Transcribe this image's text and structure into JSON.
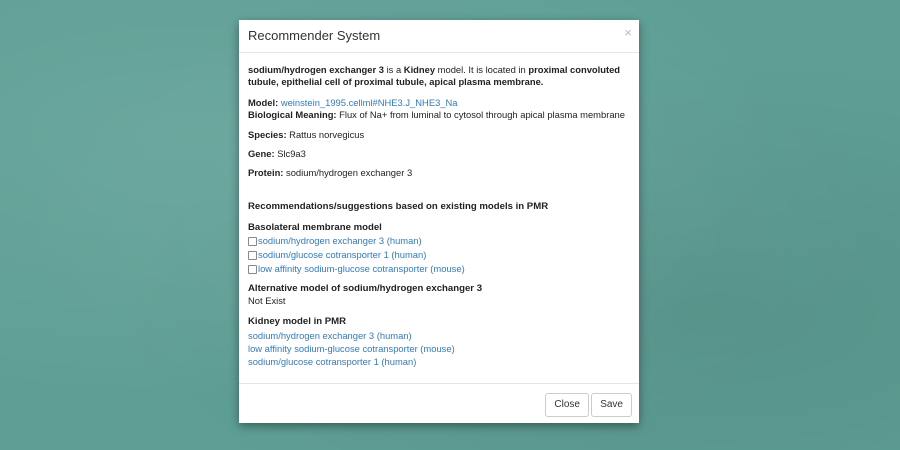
{
  "modal": {
    "title": "Recommender System",
    "close_icon": "×"
  },
  "intro": {
    "model_name": "sodium/hydrogen exchanger 3",
    "is_a": " is a ",
    "organ": "Kidney",
    "located_text": " model. It is located in ",
    "location": "proximal convoluted tubule, epithelial cell of proximal tubule, apical plasma membrane."
  },
  "details": {
    "model_label": "Model:",
    "model_value": "weinstein_1995.cellml#NHE3.J_NHE3_Na",
    "meaning_label": "Biological Meaning:",
    "meaning_value": "Flux of Na+ from luminal to cytosol through apical plasma membrane",
    "species_label": "Species:",
    "species_value": "Rattus norvegicus",
    "gene_label": "Gene:",
    "gene_value": "Slc9a3",
    "protein_label": "Protein:",
    "protein_value": "sodium/hydrogen exchanger 3"
  },
  "recommendations": {
    "heading": "Recommendations/suggestions based on existing models in PMR",
    "basolateral": {
      "title": "Basolateral membrane model",
      "items": [
        {
          "label": "sodium/hydrogen exchanger 3 (human)",
          "checked": false
        },
        {
          "label": "sodium/glucose cotransporter 1 (human)",
          "checked": false
        },
        {
          "label": "low affinity sodium-glucose cotransporter (mouse)",
          "checked": false
        }
      ]
    },
    "alternative": {
      "title": "Alternative model of sodium/hydrogen exchanger 3",
      "value": "Not Exist"
    },
    "kidney": {
      "title": "Kidney model in PMR",
      "items": [
        "sodium/hydrogen exchanger 3 (human)",
        "low affinity sodium-glucose cotransporter (mouse)",
        "sodium/glucose cotransporter 1 (human)"
      ]
    }
  },
  "footer": {
    "close_label": "Close",
    "save_label": "Save"
  },
  "colors": {
    "background": "#5e9f95",
    "link": "#337ab7"
  }
}
